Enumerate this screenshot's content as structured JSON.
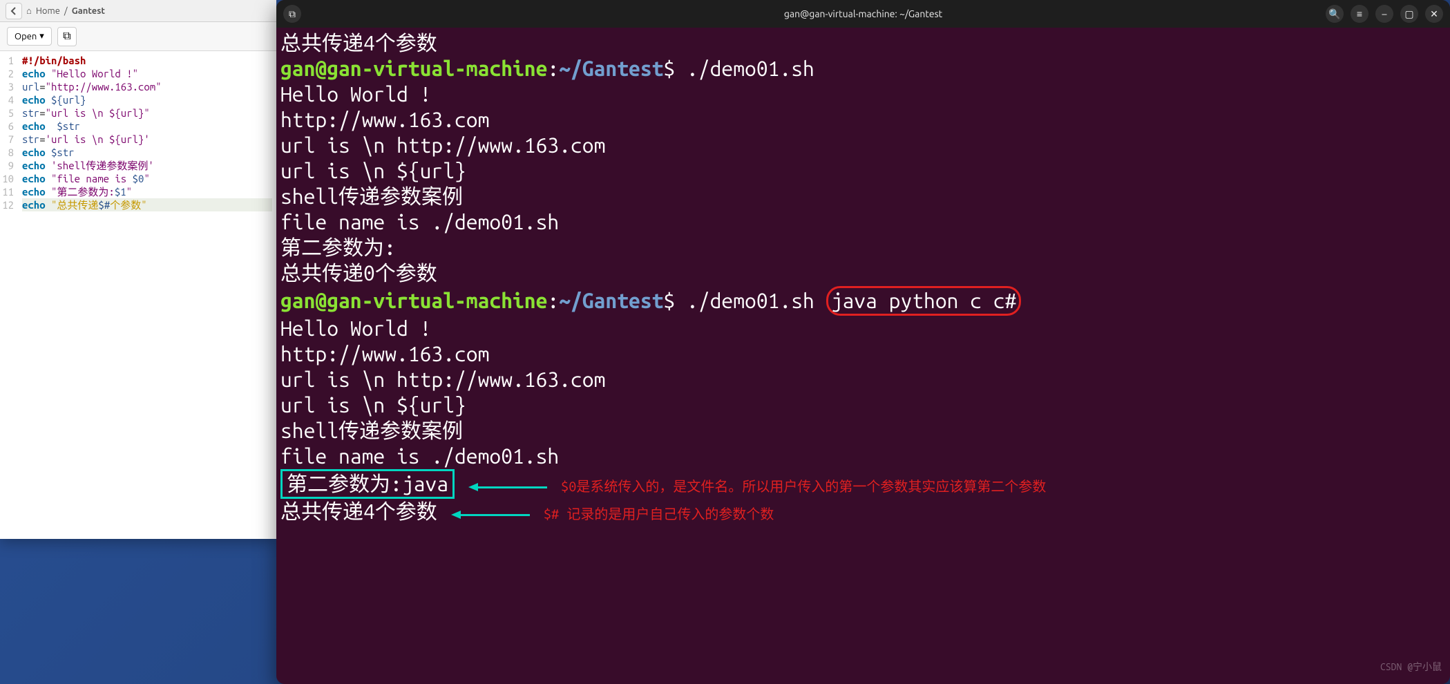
{
  "editor": {
    "breadcrumb": {
      "home_icon": "⌂",
      "home": "Home",
      "sep": "/",
      "folder": "Gantest"
    },
    "toolbar": {
      "open_label": "Open",
      "new_tab_icon": "⧉"
    },
    "line_numbers": [
      "1",
      "2",
      "3",
      "4",
      "5",
      "6",
      "7",
      "8",
      "9",
      "10",
      "11",
      "12"
    ]
  },
  "code": {
    "l1_shebang": "#!/bin/bash",
    "l2_cmd": "echo",
    "l2_str": "\"Hello World !\"",
    "l3_var": "url",
    "l3_eq": "=",
    "l3_str": "\"http://www.163.com\"",
    "l4_cmd": "echo",
    "l4_arg": " ${url}",
    "l5_var": "str",
    "l5_eq": "=",
    "l5_str": "\"url is \\n ${url}\"",
    "l6_cmd": "echo",
    "l6_arg": "  $str",
    "l7_var": "str",
    "l7_eq": "=",
    "l7_str": "'url is \\n ${url}'",
    "l8_cmd": "echo",
    "l8_arg": " $str",
    "l9_cmd": "echo",
    "l9_str": " 'shell传递参数案例'",
    "l10_cmd": "echo",
    "l10_str": " \"file name is ",
    "l10_v": "$0",
    "l10_end": "\"",
    "l11_cmd": "echo",
    "l11_str": " \"第二参数为:",
    "l11_v": "$1",
    "l11_end": "\"",
    "l12_cmd": "echo",
    "l12_str": " \"总共传递",
    "l12_v": "$#",
    "l12_end": "个参数\""
  },
  "terminal": {
    "title": "gan@gan-virtual-machine: ~/Gantest",
    "icons": {
      "newtab": "⧉",
      "search": "🔍",
      "menu": "≡",
      "min": "–",
      "max": "▢",
      "close": "✕"
    },
    "user": "gan",
    "host": "@gan-virtual-machine",
    "colon": ":",
    "path": "~/Gantest",
    "prompt": "$ ",
    "cmd1": "./demo01.sh",
    "out": {
      "top": "总共传递4个参数",
      "hello": "Hello World !",
      "url": "http://www.163.com",
      "urlis1": "url is \\n http://www.163.com",
      "urlis2": "url is \\n ${url}",
      "shellcase": "shell传递参数案例",
      "fname": "file name is ./demo01.sh",
      "arg2_a": "第二参数为:",
      "total0": "总共传递0个参数",
      "cmd2_pre": "./demo01.sh ",
      "cmd2_args": "java python c c#",
      "arg2_b": "第二参数为:java",
      "total4": "总共传递4个参数"
    },
    "notes": {
      "n1": "$0是系统传入的，是文件名。所以用户传入的第一个参数其实应该算第二个参数",
      "n2": "$# 记录的是用户自己传入的参数个数"
    },
    "watermark": "CSDN @宁小鼠"
  }
}
